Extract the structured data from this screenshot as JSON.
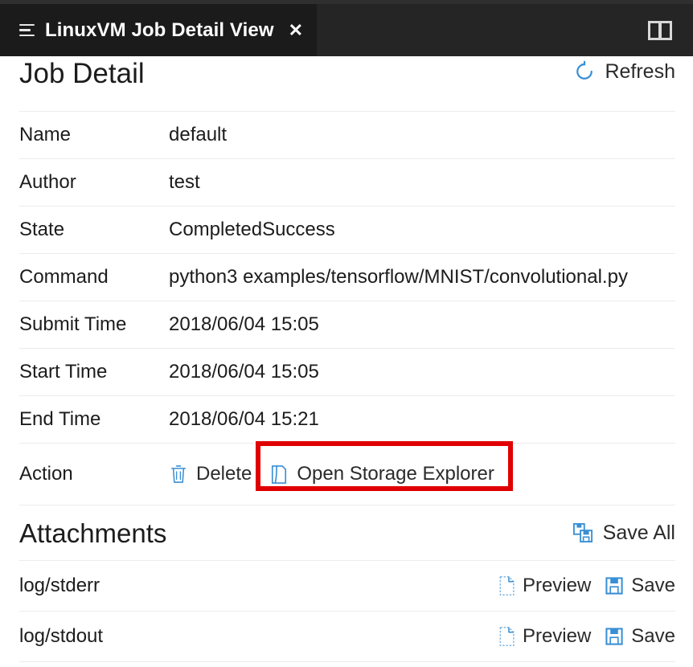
{
  "window": {
    "tab": {
      "title": "LinuxVM Job Detail View",
      "menu_icon": "list-menu-icon",
      "close_icon": "close-icon",
      "close_label": "✕"
    },
    "layout_toggle_icon": "split-panel-icon",
    "colors": {
      "titlebar_bg": "#252526",
      "tab_bg": "#1b1b1b",
      "accent_blue": "#3a8fd4",
      "highlight_red": "#e00000",
      "text_dark": "#1c1c1c",
      "divider": "#ececec"
    }
  },
  "header": {
    "title": "Job Detail",
    "refresh": {
      "label": "Refresh",
      "icon": "refresh-circular-arrow-icon"
    }
  },
  "detail": {
    "rows": [
      {
        "label": "Name",
        "value": "default"
      },
      {
        "label": "Author",
        "value": "test"
      },
      {
        "label": "State",
        "value": "CompletedSuccess"
      },
      {
        "label": "Command",
        "value": "python3 examples/tensorflow/MNIST/convolutional.py"
      },
      {
        "label": "Submit Time",
        "value": "2018/06/04 15:05"
      },
      {
        "label": "Start Time",
        "value": "2018/06/04 15:05"
      },
      {
        "label": "End Time",
        "value": "2018/06/04 15:21"
      }
    ],
    "action": {
      "label": "Action",
      "buttons": [
        {
          "label": "Delete",
          "icon": "trash-icon"
        },
        {
          "label": "Open Storage Explorer",
          "icon": "storage-folder-icon",
          "highlighted": true
        }
      ]
    }
  },
  "attachments": {
    "title": "Attachments",
    "save_all": {
      "label": "Save All",
      "icon": "save-all-floppy-icon"
    },
    "items": [
      {
        "name": "log/stderr",
        "preview": {
          "label": "Preview",
          "icon": "preview-document-icon"
        },
        "save": {
          "label": "Save",
          "icon": "save-floppy-icon"
        }
      },
      {
        "name": "log/stdout",
        "preview": {
          "label": "Preview",
          "icon": "preview-document-icon"
        },
        "save": {
          "label": "Save",
          "icon": "save-floppy-icon"
        }
      }
    ]
  }
}
